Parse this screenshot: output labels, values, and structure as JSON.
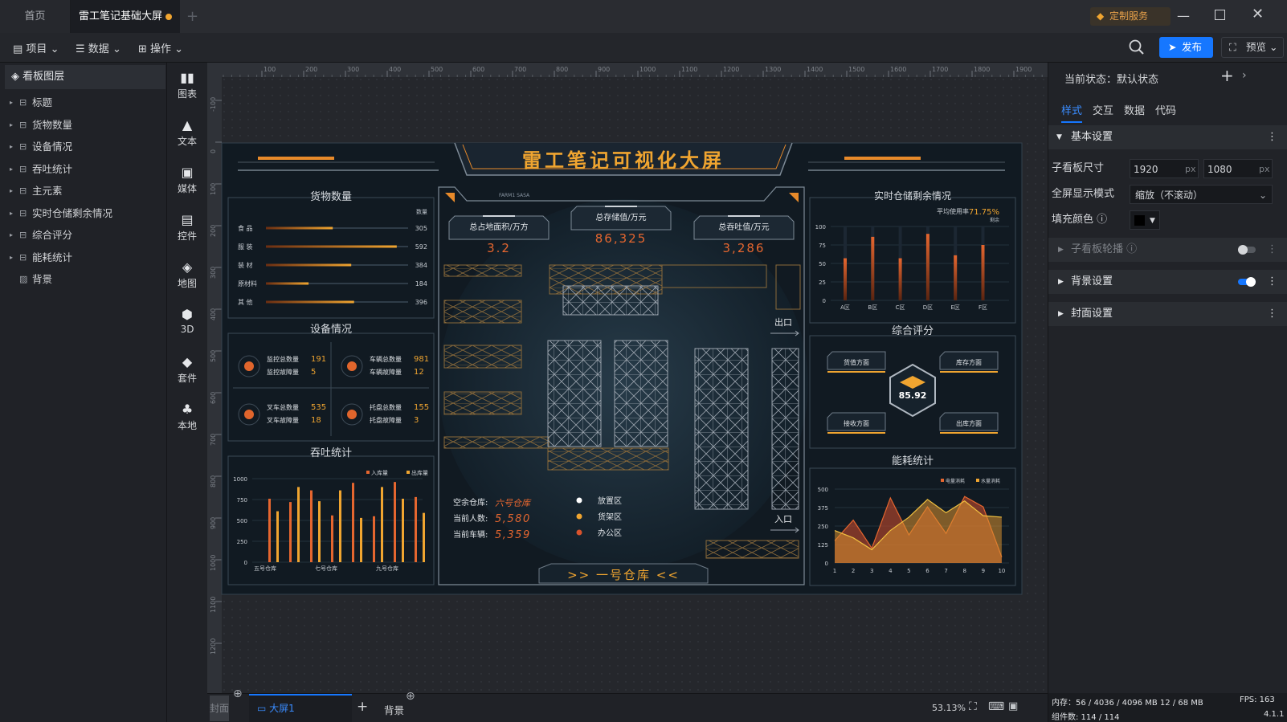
{
  "tabs": {
    "home": "首页",
    "active": "雷工笔记基础大屏",
    "plus": "+",
    "custom": "定制服务"
  },
  "toolbar": {
    "project": "项目",
    "data": "数据",
    "operate": "操作",
    "publish": "发布",
    "preview": "预览"
  },
  "layers": {
    "title": "看板图层",
    "items": [
      "标题",
      "货物数量",
      "设备情况",
      "吞吐统计",
      "主元素",
      "实时仓储剩余情况",
      "综合评分",
      "能耗统计",
      "背景"
    ]
  },
  "components": [
    "图表",
    "文本",
    "媒体",
    "控件",
    "地图",
    "3D",
    "套件",
    "本地"
  ],
  "ruler": {
    "top": [
      "100",
      "200",
      "300",
      "400",
      "500",
      "600",
      "700",
      "800",
      "900",
      "1000",
      "1100",
      "1200",
      "1300",
      "1400",
      "1500",
      "1600",
      "1700",
      "1800",
      "1900"
    ],
    "left": [
      "-100",
      "0",
      "100",
      "200",
      "300",
      "400",
      "500",
      "600",
      "700",
      "800",
      "900",
      "1000",
      "1100",
      "1200"
    ]
  },
  "screen": {
    "title": "雷工笔记可视化大屏",
    "small_tag": "FARM1 SASA",
    "cargo": {
      "title": "货物数量",
      "legend": "数量",
      "items": [
        {
          "label": "食 品",
          "value": "305",
          "pct": 0.47
        },
        {
          "label": "服 装",
          "value": "592",
          "pct": 0.92
        },
        {
          "label": "装 材",
          "value": "384",
          "pct": 0.6
        },
        {
          "label": "原材料",
          "value": "184",
          "pct": 0.3
        },
        {
          "label": "其 他",
          "value": "396",
          "pct": 0.62
        }
      ]
    },
    "equip": {
      "title": "设备情况",
      "groups": [
        {
          "l1": "监控总数量",
          "v1": "191",
          "l2": "监控故障量",
          "v2": "5"
        },
        {
          "l1": "车辆总数量",
          "v1": "981",
          "l2": "车辆故障量",
          "v2": "12"
        },
        {
          "l1": "叉车总数量",
          "v1": "535",
          "l2": "叉车故障量",
          "v2": "18"
        },
        {
          "l1": "托盘总数量",
          "v1": "155",
          "l2": "托盘故障量",
          "v2": "3"
        }
      ]
    },
    "through": {
      "title": "吞吐统计",
      "legend": [
        "入库量",
        "出库量"
      ]
    },
    "stats": [
      {
        "label": "总占地面积/万方",
        "value": "3.2"
      },
      {
        "label": "总存储值/万元",
        "value": "86,325"
      },
      {
        "label": "总吞吐值/万元",
        "value": "3,286"
      }
    ],
    "info": {
      "l1": "空余仓库:",
      "v1": "六号仓库",
      "l2": "当前人数:",
      "v2": "5,580",
      "l3": "当前车辆:",
      "v3": "5,359"
    },
    "zones": [
      "放置区",
      "货架区",
      "办公区"
    ],
    "zone_colors": [
      "#ffffff",
      "#f0a530",
      "#d9532c"
    ],
    "exit": "出口",
    "entrance": "入口",
    "warehouse": ">> 一号仓库 <<",
    "storage": {
      "title": "实时仓储剩余情况",
      "sub": "平均使用率",
      "rate": "71.75%",
      "legend": "剩余"
    },
    "score": {
      "title": "综合评分",
      "value": "85.92",
      "labels": [
        "货值方面",
        "库存方面",
        "接收方面",
        "出库方面"
      ]
    },
    "energy": {
      "title": "能耗统计",
      "legend": [
        "电量消耗",
        "水量消耗"
      ]
    }
  },
  "chart_data": [
    {
      "type": "bar",
      "title": "货物数量",
      "categories": [
        "食 品",
        "服 装",
        "装 材",
        "原材料",
        "其 他"
      ],
      "values": [
        305,
        592,
        384,
        184,
        396
      ]
    },
    {
      "type": "bar",
      "title": "实时仓储剩余情况",
      "categories": [
        "A区",
        "B区",
        "C区",
        "D区",
        "E区",
        "F区"
      ],
      "values": [
        57,
        86,
        57,
        90,
        61,
        75
      ],
      "ylim": [
        0,
        100
      ],
      "yticks": [
        "0",
        "25",
        "50",
        "75",
        "100"
      ]
    },
    {
      "type": "bar",
      "title": "吞吐统计",
      "categories": [
        "五号仓库",
        "七号仓库",
        "九号仓库"
      ],
      "yticks": [
        "0",
        "250",
        "500",
        "750",
        "1000"
      ],
      "ylim": [
        0,
        1000
      ],
      "series": [
        {
          "name": "入库量",
          "values": [
            760,
            720,
            860,
            560,
            950,
            550,
            960,
            780
          ]
        },
        {
          "name": "出库量",
          "values": [
            610,
            900,
            730,
            860,
            530,
            900,
            760,
            590
          ]
        }
      ]
    },
    {
      "type": "area",
      "title": "能耗统计",
      "x": [
        "1",
        "2",
        "3",
        "4",
        "5",
        "6",
        "7",
        "8",
        "9",
        "10"
      ],
      "yticks": [
        "0",
        "125",
        "250",
        "375",
        "500"
      ],
      "ylim": [
        0,
        500
      ],
      "series": [
        {
          "name": "电量消耗",
          "values": [
            150,
            290,
            100,
            440,
            190,
            380,
            200,
            450,
            380,
            40
          ]
        },
        {
          "name": "水量消耗",
          "values": [
            220,
            170,
            90,
            220,
            310,
            430,
            340,
            420,
            320,
            310
          ]
        }
      ]
    }
  ],
  "bottom": {
    "cover": "封面",
    "screen": "大屏1",
    "bg": "背景",
    "zoom": "53.13%"
  },
  "props": {
    "state": "当前状态：默认状态",
    "tabs": [
      "样式",
      "交互",
      "数据",
      "代码"
    ],
    "basic": "基本设置",
    "size_label": "子看板尺寸",
    "w": "1920",
    "h": "1080",
    "unit": "px",
    "mode_label": "全屏显示模式",
    "mode": "缩放（不滚动）",
    "fill_label": "填充颜色",
    "carousel": "子看板轮播",
    "bg_settings": "背景设置",
    "cover_settings": "封面设置"
  },
  "status": {
    "memory": "内存：56 / 4036 / 4096 MB 12 / 68 MB",
    "fps": "FPS: 163",
    "components": "组件数: 114 / 114",
    "version": "4.1.1"
  }
}
